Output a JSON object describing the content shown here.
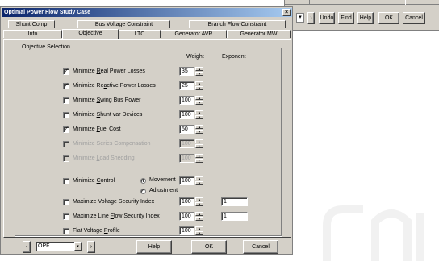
{
  "background_window": {
    "dropdown_arrow": "▾",
    "buttons": [
      {
        "name": "nav-next-button",
        "label": "›"
      },
      {
        "name": "undo-button",
        "label": "Undo"
      },
      {
        "name": "find-button",
        "label": "Find"
      },
      {
        "name": "help-button",
        "label": "Help"
      },
      {
        "name": "ok-button",
        "label": "OK"
      },
      {
        "name": "cancel-button",
        "label": "Cancel"
      }
    ]
  },
  "dialog": {
    "title": "Optimal Power Flow Study Case",
    "close_glyph": "×",
    "tabs_back": [
      "Shunt Comp",
      "Bus Voltage Constraint",
      "Branch Flow Constraint"
    ],
    "tabs_front": [
      "Info",
      "Objective",
      "LTC",
      "Generator AVR",
      "Generator MW"
    ],
    "active_tab": "Objective",
    "group_label": "Objective Selection",
    "col_weight": "Weight",
    "col_exponent": "Exponent",
    "objectives": [
      {
        "label_pre": "Minimize ",
        "label_key": "R",
        "label_post": "eal Power Losses",
        "checked": true,
        "enabled": true,
        "weight": "35",
        "exponent": null
      },
      {
        "label_pre": "Minimize Re",
        "label_key": "a",
        "label_post": "ctive Power Losses",
        "checked": true,
        "enabled": true,
        "weight": "25",
        "exponent": null
      },
      {
        "label_pre": "Minimize ",
        "label_key": "S",
        "label_post": "wing Bus Power",
        "checked": false,
        "enabled": true,
        "weight": "100",
        "exponent": null
      },
      {
        "label_pre": "Minimize ",
        "label_key": "S",
        "label_post": "hunt var Devices",
        "checked": false,
        "enabled": true,
        "weight": "100",
        "exponent": null
      },
      {
        "label_pre": "Minimize ",
        "label_key": "F",
        "label_post": "uel Cost",
        "checked": true,
        "enabled": true,
        "weight": "50",
        "exponent": null
      },
      {
        "label_pre": "Minimize Series Compensation",
        "label_key": "",
        "label_post": "",
        "checked": false,
        "enabled": false,
        "weight": "100",
        "exponent": null
      },
      {
        "label_pre": "Minimize ",
        "label_key": "L",
        "label_post": "oad Shedding",
        "checked": false,
        "enabled": false,
        "weight": "100",
        "exponent": null
      },
      {
        "label_pre": "Minimize ",
        "label_key": "C",
        "label_post": "ontrol",
        "checked": false,
        "enabled": true,
        "weight": "100",
        "exponent": null
      },
      {
        "label_pre": "Maximize Voltage Security Index",
        "label_key": "",
        "label_post": "",
        "checked": false,
        "enabled": true,
        "weight": "100",
        "exponent": "1"
      },
      {
        "label_pre": "Maximize Line ",
        "label_key": "F",
        "label_post": "low Security Index",
        "checked": false,
        "enabled": true,
        "weight": "100",
        "exponent": "1"
      },
      {
        "label_pre": "Flat Voltage ",
        "label_key": "P",
        "label_post": "rofile",
        "checked": false,
        "enabled": true,
        "weight": "100",
        "exponent": null
      }
    ],
    "control_mode": {
      "movement": "Movement",
      "adjustment_key": "A",
      "adjustment_rest": "djustment",
      "selected": "movement"
    },
    "footer": {
      "prev_glyph": "‹",
      "next_glyph": "›",
      "combo_value": "OPF",
      "combo_arrow": "▾",
      "help": "Help",
      "ok": "OK",
      "cancel": "Cancel"
    },
    "spin_up": "▲",
    "spin_down": "▼",
    "check_glyph": "✓"
  }
}
